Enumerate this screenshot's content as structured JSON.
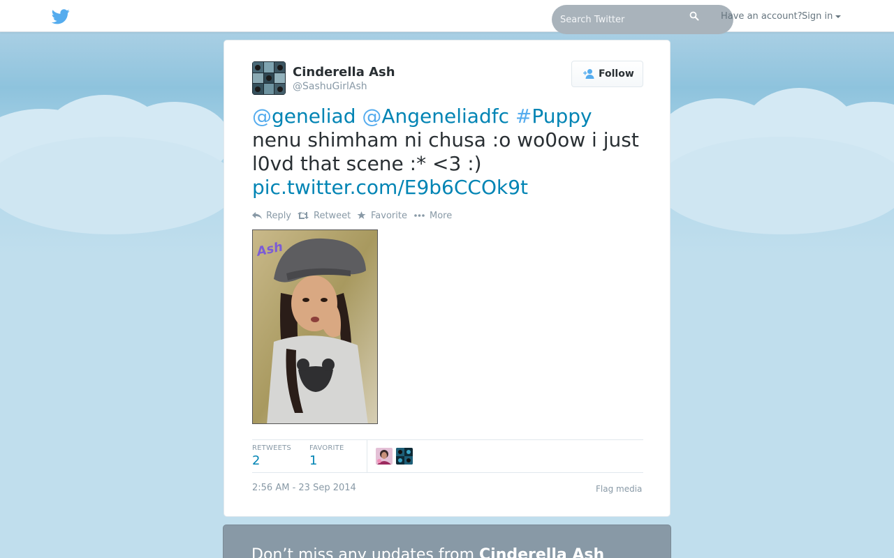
{
  "topbar": {
    "search_placeholder": "Search Twitter",
    "have_account": "Have an account?",
    "signin_label": "Sign in"
  },
  "tweet": {
    "fullname": "Cinderella Ash",
    "username": "@SashuGirlAsh",
    "follow_label": "Follow",
    "text": {
      "mention1_at": "@",
      "mention1": "geneliad",
      "mention2_at": "@",
      "mention2": "Angeneliadfc",
      "hashtag_hash": "#",
      "hashtag": "Puppy",
      "body": "nenu shimham ni chusa :o wo0ow i just l0vd that scene :* <3 :)",
      "pic_link": "pic.twitter.com/E9b6CCOk9t"
    },
    "actions": {
      "reply": "Reply",
      "retweet": "Retweet",
      "favorite": "Favorite",
      "more": "More"
    },
    "media_overlay": "Ash",
    "stats": {
      "retweets_label": "RETWEETS",
      "retweets_value": "2",
      "favorites_label": "FAVORITE",
      "favorites_value": "1"
    },
    "timestamp": "2:56 AM - 23 Sep 2014",
    "flag_media": "Flag media"
  },
  "banner": {
    "prefix": "Don’t miss any updates from ",
    "name": "Cinderella Ash"
  },
  "colors": {
    "link": "#0084b4",
    "twitter_blue": "#55acee",
    "muted": "#8899a6",
    "sky": "#c0deed"
  },
  "icons": [
    "twitter-bird-icon",
    "search-icon",
    "caret-down-icon",
    "follow-person-icon",
    "reply-icon",
    "retweet-icon",
    "favorite-star-icon",
    "more-dots-icon"
  ]
}
